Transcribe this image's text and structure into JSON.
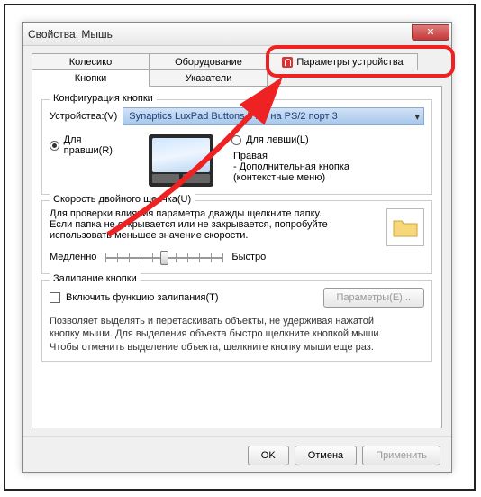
{
  "window": {
    "title": "Свойства: Мышь"
  },
  "tabs_row1": [
    "Колесико",
    "Оборудование",
    "Параметры устройства"
  ],
  "tabs_row2": [
    "Кнопки",
    "Указатели"
  ],
  "group_config": {
    "legend": "Конфигурация кнопки",
    "device_label": "Устройства:(V)",
    "device_value": "Synaptics LuxPad Buttons V7.5 на PS/2 порт 3",
    "right_handed": "Для правши(R)",
    "left_handed": "Для левши(L)",
    "detail_title": "Правая",
    "detail_line1": "- Дополнительная кнопка",
    "detail_line2": "(контекстные меню)"
  },
  "group_speed": {
    "legend": "Скорость двойного щелчка(U)",
    "desc1": "Для проверки влияния параметра дважды щелкните папку.",
    "desc2": "Если папка не открывается или не закрывается, попробуйте",
    "desc3": "использовать меньшее значение скорости.",
    "slow": "Медленно",
    "fast": "Быстро"
  },
  "group_stick": {
    "legend": "Залипание кнопки",
    "checkbox": "Включить функцию залипания(T)",
    "params_btn": "Параметры(E)...",
    "desc1": "Позволяет выделять и перетаскивать объекты, не удерживая нажатой",
    "desc2": "кнопку мыши. Для выделения объекта быстро щелкните кнопкой мыши.",
    "desc3": "Чтобы отменить выделение объекта, щелкните кнопку мыши еще раз."
  },
  "buttons": {
    "ok": "OK",
    "cancel": "Отмена",
    "apply": "Применить"
  }
}
